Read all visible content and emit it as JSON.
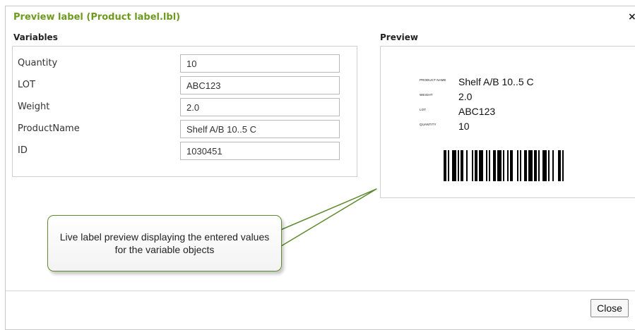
{
  "dialog": {
    "title": "Preview label (Product label.lbl)",
    "close_icon": "×",
    "close_button": "Close"
  },
  "variables": {
    "heading": "Variables",
    "rows": [
      {
        "label": "Quantity",
        "value": "10"
      },
      {
        "label": "LOT",
        "value": "ABC123"
      },
      {
        "label": "Weight",
        "value": "2.0"
      },
      {
        "label": "ProductName",
        "value": "Shelf A/B 10..5 C"
      },
      {
        "label": "ID",
        "value": "1030451"
      }
    ]
  },
  "preview": {
    "heading": "Preview",
    "label_fields": [
      {
        "key": "PRODUCT NAME",
        "value": "Shelf A/B 10..5 C"
      },
      {
        "key": "WEIGHT",
        "value": "2.0"
      },
      {
        "key": "LOT",
        "value": "ABC123"
      },
      {
        "key": "QUANTITY",
        "value": "10"
      }
    ],
    "barcode_icon": "barcode"
  },
  "callout": {
    "text": "Live label preview displaying the entered values for the variable objects",
    "border_color": "#5f8a2f"
  },
  "colors": {
    "title": "#6e9a1f"
  }
}
